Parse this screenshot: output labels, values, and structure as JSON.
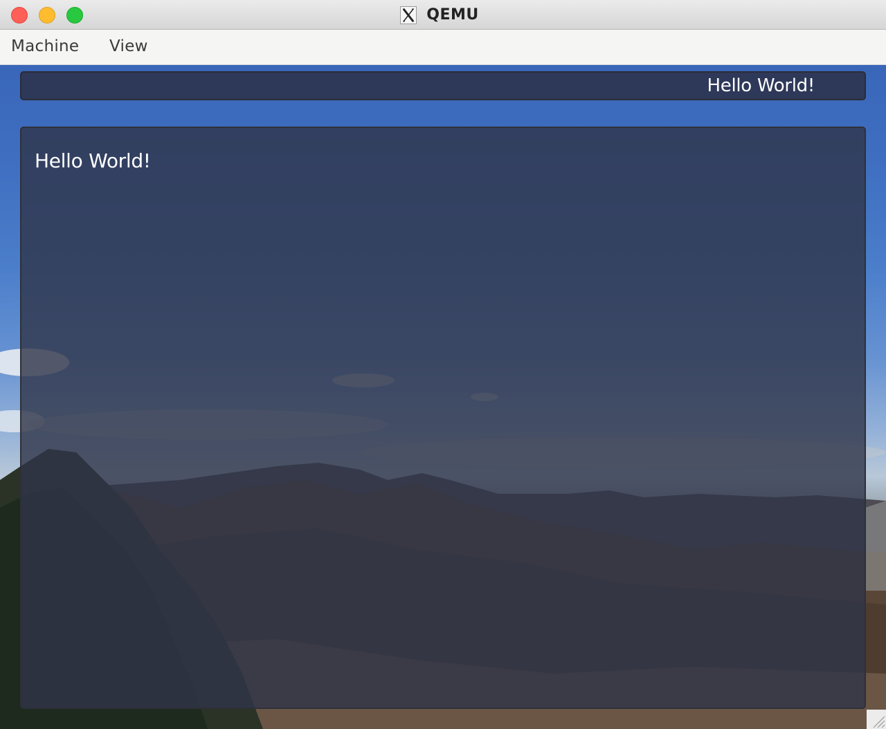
{
  "window": {
    "title": "QEMU",
    "title_icon": "x11-icon"
  },
  "traffic_lights": {
    "close_color": "#fe5f57",
    "minimize_color": "#febc2e",
    "zoom_color": "#28c840"
  },
  "menubar": {
    "items": [
      {
        "label": "Machine"
      },
      {
        "label": "View"
      }
    ]
  },
  "guest": {
    "top_panel": {
      "text": "Hello World!"
    },
    "main_window": {
      "text": "Hello World!"
    },
    "wallpaper": "mountain-landscape"
  }
}
